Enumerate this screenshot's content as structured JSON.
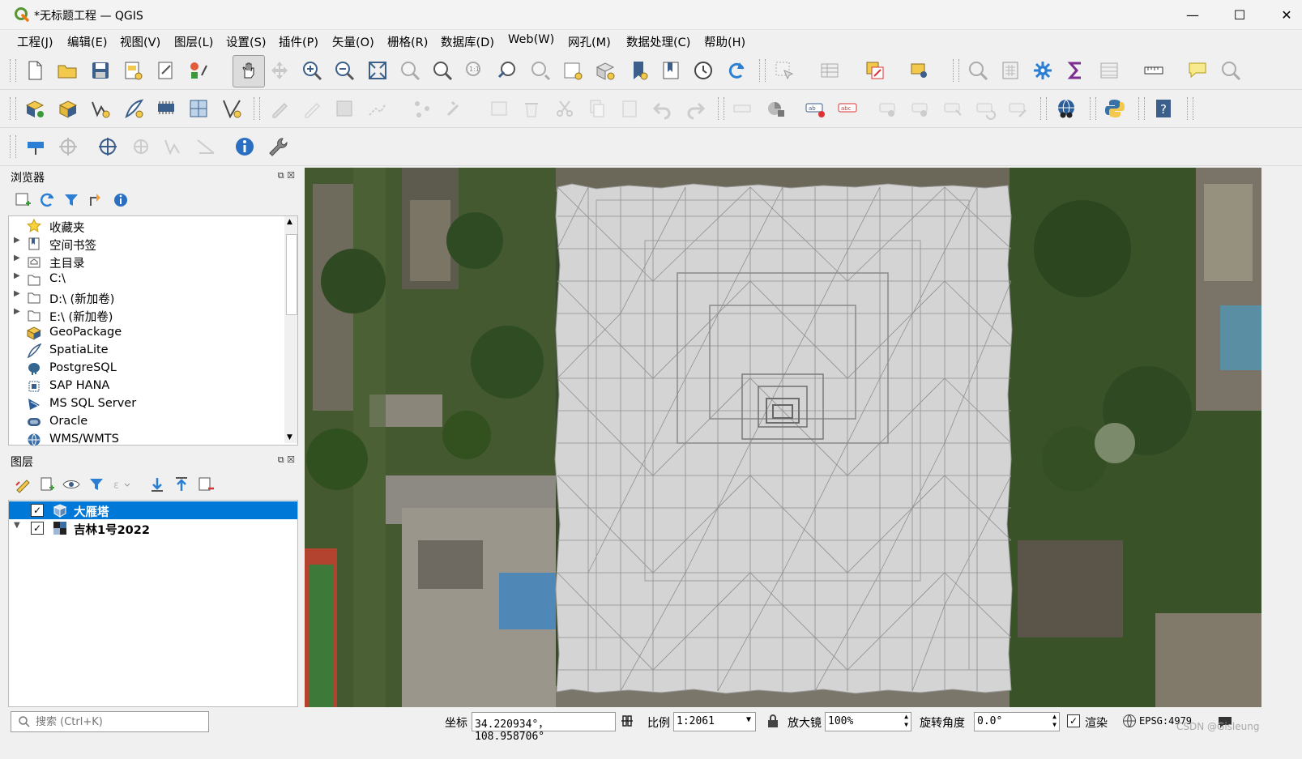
{
  "window": {
    "title": "*无标题工程 — QGIS",
    "controls": {
      "minimize": "—",
      "maximize": "☐",
      "close": "✕"
    }
  },
  "menu": [
    "工程(J)",
    "编辑(E)",
    "视图(V)",
    "图层(L)",
    "设置(S)",
    "插件(P)",
    "矢量(O)",
    "栅格(R)",
    "数据库(D)",
    "Web(W)",
    "网孔(M)",
    "数据处理(C)",
    "帮助(H)"
  ],
  "browser": {
    "title": "浏览器",
    "items": [
      {
        "label": "收藏夹",
        "icon": "star-icon",
        "expandable": false
      },
      {
        "label": "空间书签",
        "icon": "bookmark-icon",
        "expandable": true
      },
      {
        "label": "主目录",
        "icon": "home-folder-icon",
        "expandable": true
      },
      {
        "label": "C:\\",
        "icon": "folder-icon",
        "expandable": true
      },
      {
        "label": "D:\\ (新加卷)",
        "icon": "folder-icon",
        "expandable": true
      },
      {
        "label": "E:\\ (新加卷)",
        "icon": "folder-icon",
        "expandable": true
      },
      {
        "label": "GeoPackage",
        "icon": "geopackage-icon",
        "expandable": false
      },
      {
        "label": "SpatiaLite",
        "icon": "spatialite-icon",
        "expandable": false
      },
      {
        "label": "PostgreSQL",
        "icon": "postgresql-icon",
        "expandable": false
      },
      {
        "label": "SAP HANA",
        "icon": "sap-hana-icon",
        "expandable": false
      },
      {
        "label": "MS SQL Server",
        "icon": "mssql-icon",
        "expandable": false
      },
      {
        "label": "Oracle",
        "icon": "oracle-icon",
        "expandable": false
      },
      {
        "label": "WMS/WMTS",
        "icon": "globe-icon",
        "expandable": false
      }
    ]
  },
  "layers": {
    "title": "图层",
    "items": [
      {
        "label": "大雁塔",
        "checked": true,
        "selected": true,
        "icon": "mesh-layer-icon"
      },
      {
        "label": "吉林1号2022",
        "checked": true,
        "selected": false,
        "icon": "raster-layer-icon"
      }
    ]
  },
  "status": {
    "search_placeholder": "搜索 (Ctrl+K)",
    "coord_label": "坐标",
    "coord_value": "34.220934°， 108.958706°",
    "scale_label": "比例",
    "scale_value": "1:2061",
    "magnifier_label": "放大镜",
    "magnifier_value": "100%",
    "rotation_label": "旋转角度",
    "rotation_value": "0.0°",
    "render_label": "渲染",
    "render_checked": true,
    "crs": "EPSG:4979"
  },
  "watermark": "CSDN @Gisleung",
  "colors": {
    "selection": "#0078d7",
    "map_gray": "#d4d4d4"
  }
}
